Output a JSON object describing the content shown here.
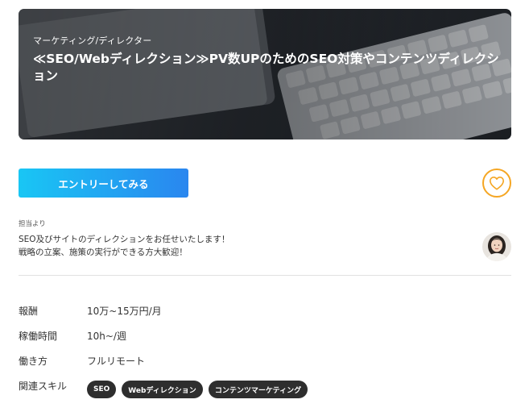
{
  "hero": {
    "category": "マーケティング/ディレクター",
    "title": "≪SEO/Webディレクション≫PV数UPのためのSEO対策やコンテンツディレクション"
  },
  "actions": {
    "entry_label": "エントリーしてみる",
    "favorite_icon": "heart-icon"
  },
  "contact": {
    "label": "担当より",
    "message_line1": "SEO及びサイトのディレクションをお任せいたします！",
    "message_line2": "戦略の立案、施策の実行ができる方大歓迎！"
  },
  "details": {
    "reward_label": "報酬",
    "reward_value": "10万~15万円/月",
    "hours_label": "稼働時間",
    "hours_value": "10h~/週",
    "style_label": "働き方",
    "style_value": "フルリモート",
    "skills_label": "関連スキル",
    "skills": [
      "SEO",
      "Webディレクション",
      "コンテンツマーケティング"
    ]
  },
  "colors": {
    "accent_start": "#19c6f4",
    "accent_end": "#2a86ef",
    "favorite": "#f5a623",
    "tag_bg": "#2e2e2e"
  }
}
